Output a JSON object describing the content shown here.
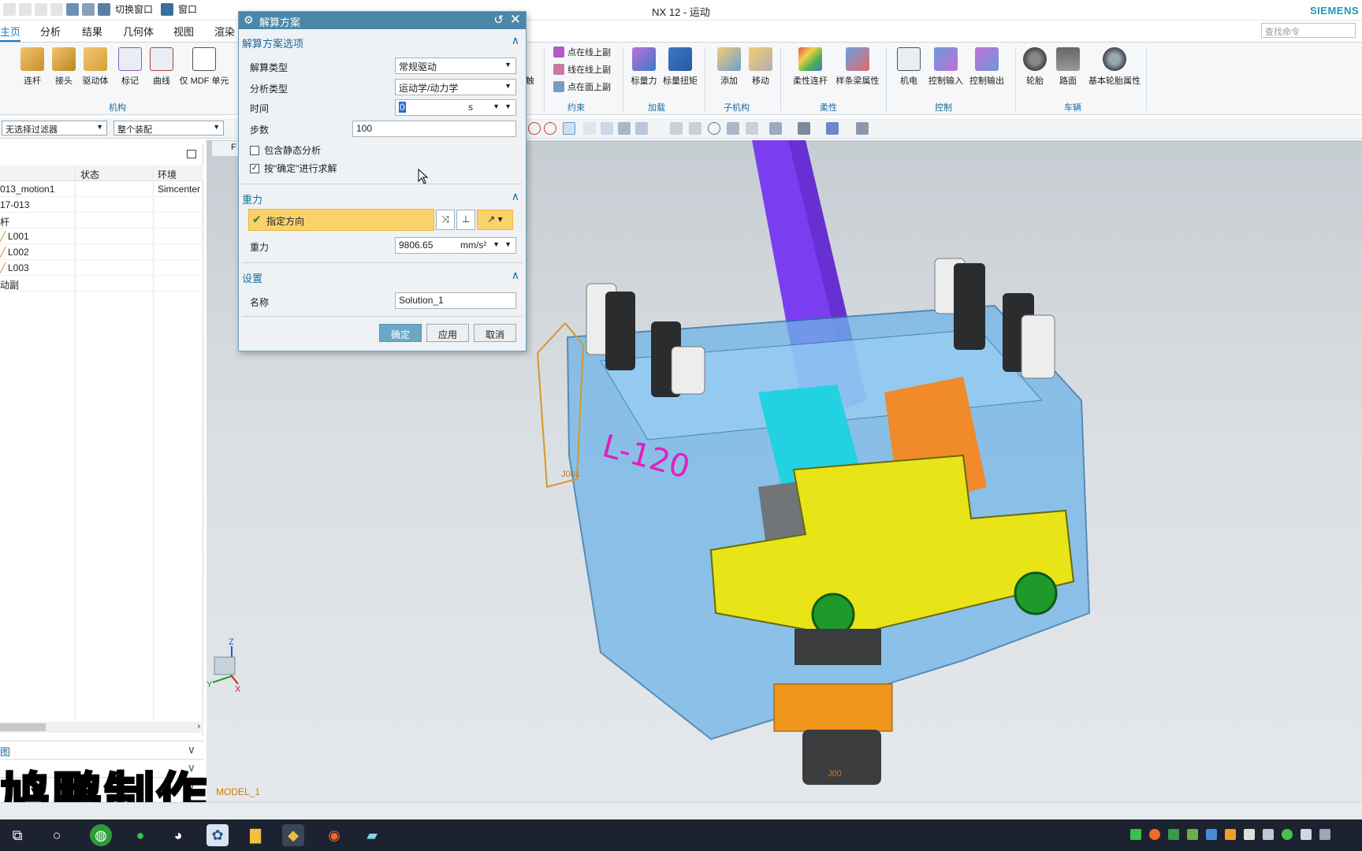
{
  "window": {
    "title": "NX 12 - 运动",
    "brand": "SIEMENS",
    "qat": {
      "switch_window": "切换窗口",
      "window": "窗口"
    }
  },
  "tabs": [
    "主页",
    "分析",
    "结果",
    "几何体",
    "视图",
    "渲染"
  ],
  "search_placeholder": "查找命令",
  "ribbon": {
    "mechanism": {
      "label": "机构",
      "buttons": [
        "连杆",
        "接头",
        "驱动体",
        "标记",
        "曲线",
        "仅 MDF 单元"
      ]
    },
    "constraint": {
      "label": "约束",
      "links": [
        "点在线上副",
        "线在线上副",
        "点在面上副"
      ],
      "partial": "触"
    },
    "load": {
      "label": "加载",
      "buttons": [
        "标量力",
        "标量扭矩"
      ]
    },
    "submech": {
      "label": "子机构",
      "buttons": [
        "添加",
        "移动"
      ]
    },
    "flex": {
      "label": "柔性",
      "buttons": [
        "柔性连杆",
        "样条梁属性"
      ]
    },
    "control": {
      "label": "控制",
      "buttons": [
        "机电",
        "控制输入",
        "控制输出"
      ]
    },
    "vehicle": {
      "label": "车辆",
      "buttons": [
        "轮胎",
        "路面",
        "基本轮胎属性"
      ]
    }
  },
  "filter": {
    "selection_filter": "无选择过滤器",
    "scope": "整个装配"
  },
  "navigator": {
    "headers": [
      "状态",
      "环境"
    ],
    "rows": [
      {
        "name": "013_motion1",
        "env": "Simcenter"
      },
      {
        "name": "17-013",
        "env": ""
      },
      {
        "name": "杆",
        "env": ""
      },
      {
        "name": "L001",
        "env": ""
      },
      {
        "name": "L002",
        "env": ""
      },
      {
        "name": "L003",
        "env": ""
      },
      {
        "name": "动副",
        "env": ""
      }
    ],
    "lower_panels": [
      "图",
      "",
      ""
    ]
  },
  "viewport": {
    "tab": "F",
    "model_label": "MODEL_1",
    "joints": [
      "J001",
      "J00"
    ],
    "triad": {
      "z": "Z",
      "y": "Y",
      "x": "X"
    },
    "part_text": "L-120"
  },
  "dialog": {
    "title": "解算方案",
    "options_section": "解算方案选项",
    "solution_type_label": "解算类型",
    "solution_type_value": "常规驱动",
    "analysis_type_label": "分析类型",
    "analysis_type_value": "运动学/动力学",
    "time_label": "时间",
    "time_value": "0",
    "time_unit": "s",
    "steps_label": "步数",
    "steps_value": "100",
    "static_analysis_label": "包含静态分析",
    "static_analysis_checked": false,
    "solve_on_ok_label": "按\"确定\"进行求解",
    "solve_on_ok_checked": true,
    "gravity_section": "重力",
    "direction_label": "指定方向",
    "gravity_label": "重力",
    "gravity_value": "9806.65",
    "gravity_unit": "mm/s²",
    "settings_section": "设置",
    "name_label": "名称",
    "name_value": "Solution_1",
    "ok_label": "确定",
    "apply_label": "应用",
    "cancel_label": "取消"
  },
  "watermark": "鸠鹏制作",
  "colors": {
    "dialog_title": "#4a87a9",
    "accent": "#1b6aa0",
    "highlight": "#fad26a"
  }
}
